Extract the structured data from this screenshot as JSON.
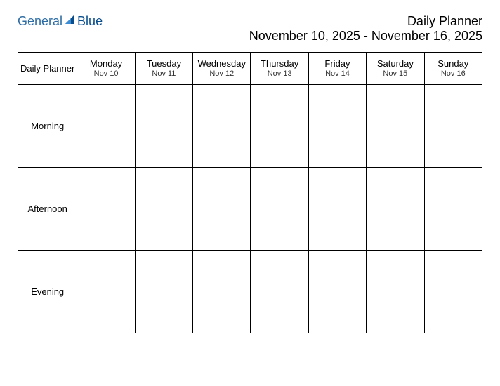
{
  "logo": {
    "text1": "General",
    "text2": "Blue"
  },
  "header": {
    "title": "Daily Planner",
    "date_range": "November 10, 2025 - November 16, 2025"
  },
  "table": {
    "corner_label": "Daily Planner",
    "days": [
      {
        "name": "Monday",
        "date": "Nov 10"
      },
      {
        "name": "Tuesday",
        "date": "Nov 11"
      },
      {
        "name": "Wednesday",
        "date": "Nov 12"
      },
      {
        "name": "Thursday",
        "date": "Nov 13"
      },
      {
        "name": "Friday",
        "date": "Nov 14"
      },
      {
        "name": "Saturday",
        "date": "Nov 15"
      },
      {
        "name": "Sunday",
        "date": "Nov 16"
      }
    ],
    "periods": [
      "Morning",
      "Afternoon",
      "Evening"
    ]
  }
}
